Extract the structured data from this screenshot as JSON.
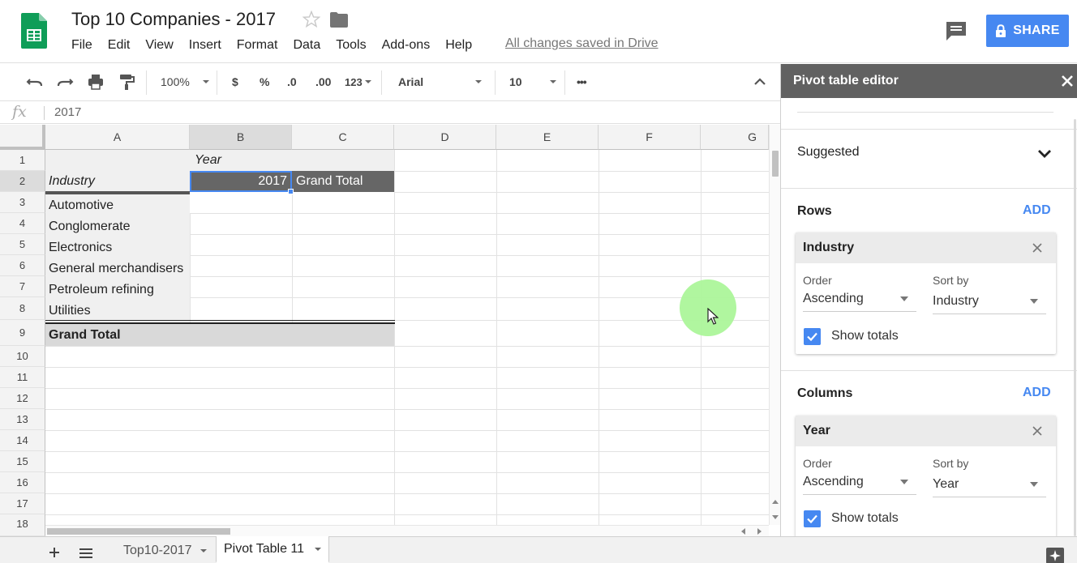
{
  "header": {
    "title": "Top 10 Companies - 2017",
    "saved_status": "All changes saved in Drive",
    "share_label": "SHARE",
    "menu": [
      "File",
      "Edit",
      "View",
      "Insert",
      "Format",
      "Data",
      "Tools",
      "Add-ons",
      "Help"
    ]
  },
  "toolbar": {
    "zoom": "100%",
    "currency": "$",
    "percent": "%",
    "decrease_decimals": ".0",
    "increase_decimals": ".00",
    "more_formats": "123",
    "font": "Arial",
    "font_size": "10",
    "more": "•••"
  },
  "formula_bar": {
    "fx": "fx",
    "value": "2017"
  },
  "grid": {
    "columns": [
      "A",
      "B",
      "C",
      "D",
      "E",
      "F",
      "G"
    ],
    "rows": [
      "1",
      "2",
      "3",
      "4",
      "5",
      "6",
      "7",
      "8",
      "9",
      "10",
      "11",
      "12",
      "13",
      "14",
      "15",
      "16",
      "17",
      "18"
    ],
    "cells": {
      "b1": "Year",
      "a2": "Industry",
      "b2": "2017",
      "c2": "Grand Total",
      "a3": "Automotive",
      "a4": "Conglomerate",
      "a5": "Electronics",
      "a6": "General merchandisers",
      "a7": "Petroleum refining",
      "a8": "Utilities",
      "a9": "Grand Total"
    }
  },
  "sheets": {
    "tabs": [
      "Top10-2017",
      "Pivot Table 11"
    ],
    "active": "Pivot Table 11"
  },
  "pivot_editor": {
    "title": "Pivot table editor",
    "suggested_label": "Suggested",
    "rows_label": "Rows",
    "columns_label": "Columns",
    "add_label": "ADD",
    "order_label": "Order",
    "sort_by_label": "Sort by",
    "show_totals_label": "Show totals",
    "rows_card": {
      "field": "Industry",
      "order": "Ascending",
      "sort_by": "Industry",
      "show_totals": true
    },
    "columns_card": {
      "field": "Year",
      "order": "Ascending",
      "sort_by": "Year",
      "show_totals": true
    }
  },
  "colors": {
    "accent": "#4688f1",
    "brand_green": "#0f9d58",
    "pivot_header": "#616161",
    "cursor_highlight": "#acf59a",
    "header_cell_dark": "#666666",
    "pivot_fill": "#f0f0f0"
  }
}
